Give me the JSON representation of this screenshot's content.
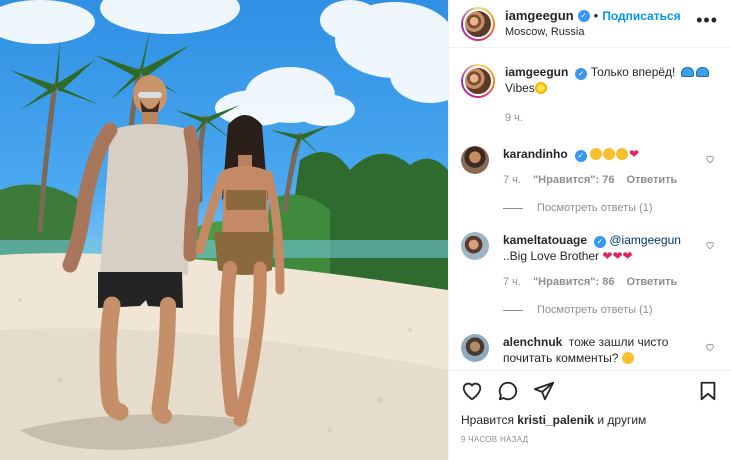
{
  "post": {
    "username": "iamgeegun",
    "verified_icon": "verified-badge-icon",
    "follow_label": "Подписаться",
    "separator": "•",
    "location": "Moscow, Russia",
    "caption_line1": "Только вперёд!",
    "caption_line2": "Vibes",
    "caption_time": "9 ч."
  },
  "comments": [
    {
      "username": "karandinho",
      "emoji_desc": [
        "star-struck-emoji",
        "star-struck-emoji",
        "star-struck-emoji",
        "red-heart-emoji"
      ],
      "time": "7 ч.",
      "likes": "\"Нравится\": 76",
      "reply_label": "Ответить",
      "view_replies": "Посмотреть ответы (1)"
    },
    {
      "username": "kameltatouage",
      "mention": "@iamgeegun",
      "text": "..Big Love Brother",
      "time": "7 ч.",
      "likes": "\"Нравится\": 86",
      "reply_label": "Ответить",
      "view_replies": "Посмотреть ответы (1)"
    },
    {
      "username": "alenchnuk",
      "text": "тоже зашли чисто почитать комменты?"
    }
  ],
  "actions": {
    "liked_by_prefix": "Нравится",
    "liked_by_user": "kristi_palenik",
    "liked_by_suffix": "и другим",
    "timestamp": "9 ЧАСОВ НАЗАД"
  },
  "colors": {
    "link_blue": "#0095f6",
    "verified_blue": "#3897f0",
    "muted": "#8e8e8e",
    "text": "#262626"
  }
}
